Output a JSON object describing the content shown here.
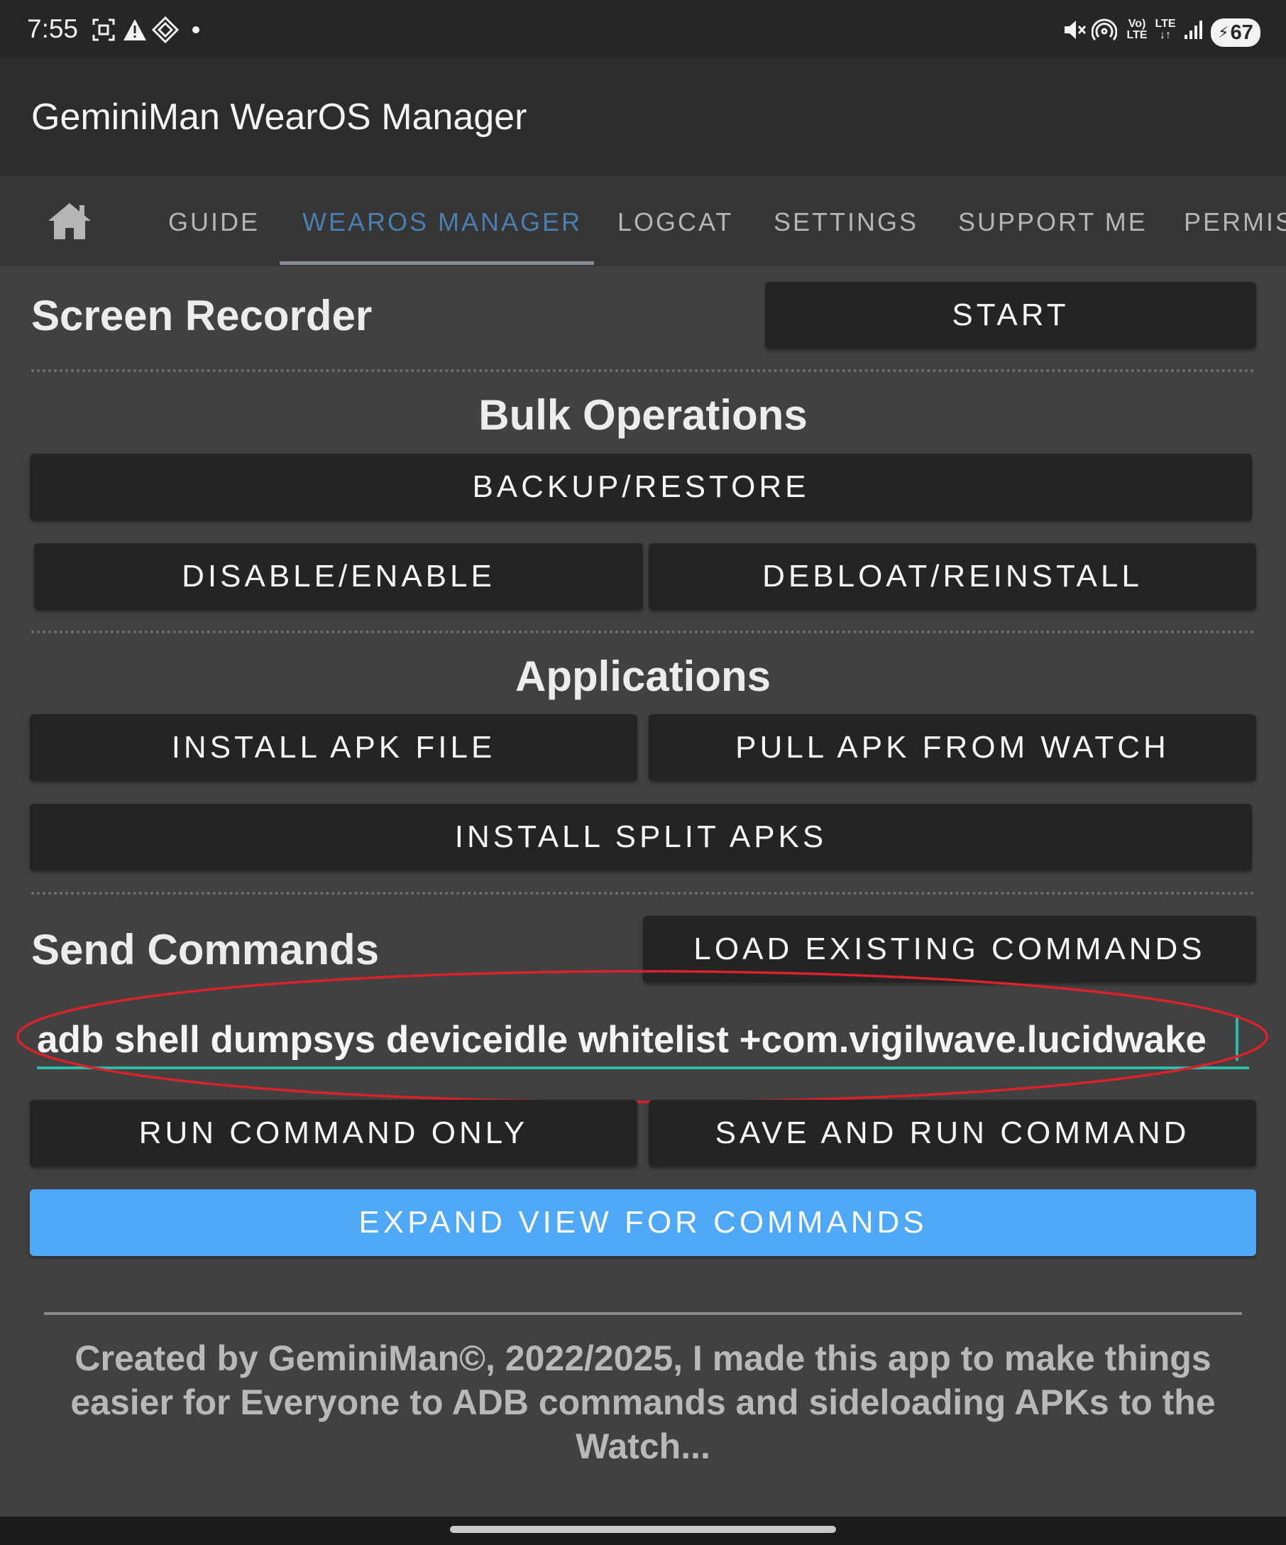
{
  "status_bar": {
    "time": "7:55",
    "battery": "67",
    "icons": [
      "screenshot-icon",
      "warning-icon",
      "diamond-app-icon",
      "dot-icon",
      "mute-icon",
      "hotspot-icon",
      "volte-icon",
      "lte-icon",
      "signal-icon",
      "battery-icon"
    ]
  },
  "app_bar": {
    "title": "GeminiMan WearOS Manager"
  },
  "tabs": [
    {
      "label": "GUIDE"
    },
    {
      "label": "WEAROS MANAGER",
      "active": true,
      "color": "#4a7fb0"
    },
    {
      "label": "LOGCAT"
    },
    {
      "label": "SETTINGS"
    },
    {
      "label": "SUPPORT ME"
    },
    {
      "label": "PERMIS"
    }
  ],
  "screen_recorder": {
    "heading": "Screen Recorder",
    "start_label": "START"
  },
  "bulk_operations": {
    "heading": "Bulk Operations",
    "backup_restore_label": "BACKUP/RESTORE",
    "disable_enable_label": "DISABLE/ENABLE",
    "debloat_reinstall_label": "DEBLOAT/REINSTALL"
  },
  "applications": {
    "heading": "Applications",
    "install_apk_label": "INSTALL APK FILE",
    "pull_apk_label": "PULL APK FROM WATCH",
    "install_split_label": "INSTALL SPLIT APKS"
  },
  "send_commands": {
    "heading": "Send Commands",
    "load_existing_label": "LOAD EXISTING COMMANDS",
    "input_value": "adb shell dumpsys deviceidle whitelist +com.vigilwave.lucidwake",
    "run_only_label": "RUN COMMAND ONLY",
    "save_and_run_label": "SAVE AND RUN COMMAND",
    "expand_view_label": "EXPAND VIEW FOR COMMANDS"
  },
  "footer": {
    "text": "Created by GeminiMan©, 2022/2025, I made this app to make things easier for Everyone to ADB commands and sideloading APKs to the Watch..."
  },
  "colors": {
    "accent_blue": "#4fa8f5",
    "input_underline": "#2fb9a8",
    "annotation_red": "#d9222a"
  }
}
